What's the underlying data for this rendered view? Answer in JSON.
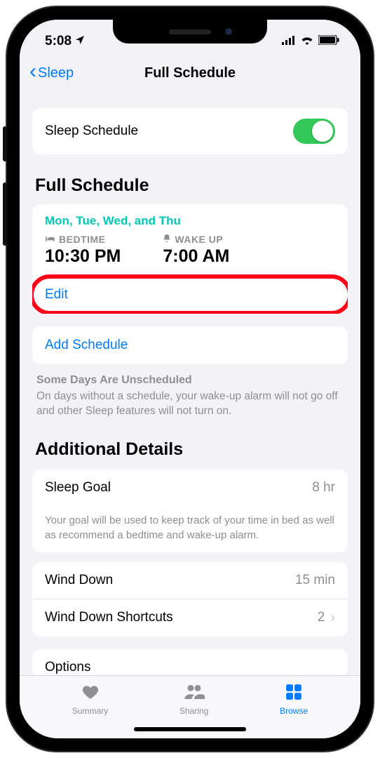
{
  "status": {
    "time": "5:08"
  },
  "nav": {
    "back_label": "Sleep",
    "title": "Full Schedule"
  },
  "sleep_schedule": {
    "label": "Sleep Schedule",
    "enabled": true
  },
  "full_schedule": {
    "header": "Full Schedule",
    "days": "Mon, Tue, Wed, and Thu",
    "bedtime_label": "BEDTIME",
    "bedtime_value": "10:30 PM",
    "wakeup_label": "WAKE UP",
    "wakeup_value": "7:00 AM",
    "edit_label": "Edit"
  },
  "add_schedule": {
    "label": "Add Schedule"
  },
  "unscheduled_note": {
    "title": "Some Days Are Unscheduled",
    "body": "On days without a schedule, your wake-up alarm will not go off and other Sleep features will not turn on."
  },
  "additional": {
    "header": "Additional Details",
    "sleep_goal_label": "Sleep Goal",
    "sleep_goal_value": "8 hr",
    "goal_footer": "Your goal will be used to keep track of your time in bed as well as recommend a bedtime and wake-up alarm.",
    "wind_down_label": "Wind Down",
    "wind_down_value": "15 min",
    "shortcuts_label": "Wind Down Shortcuts",
    "shortcuts_value": "2",
    "options_label": "Options"
  },
  "tabs": {
    "summary": "Summary",
    "sharing": "Sharing",
    "browse": "Browse"
  }
}
